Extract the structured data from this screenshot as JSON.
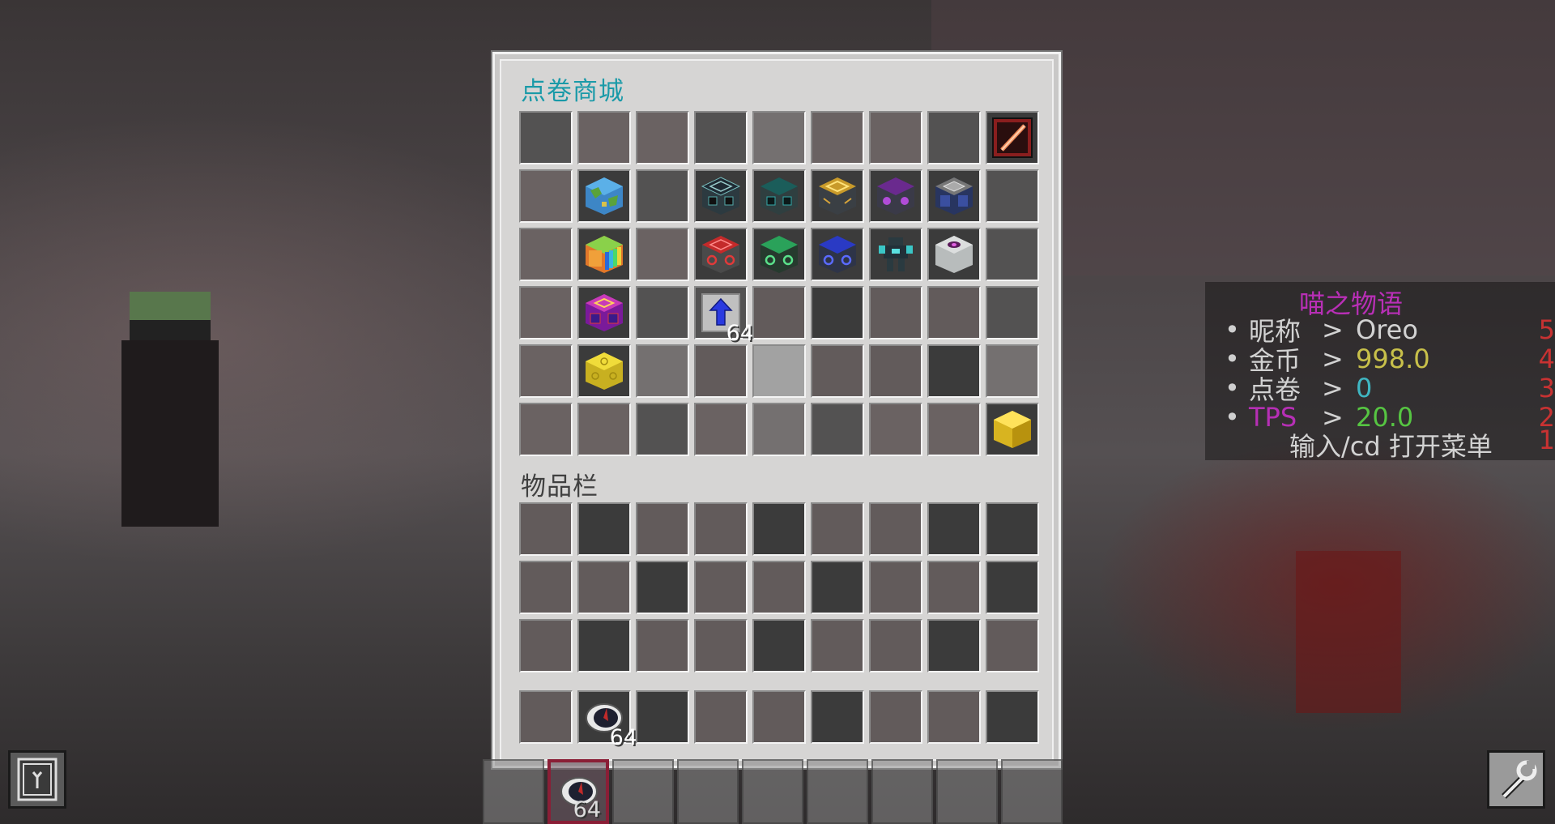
{
  "shop": {
    "title": "点卷商城",
    "slots": [
      {
        "c": "c-a"
      },
      {
        "c": "c-b"
      },
      {
        "c": "c-b"
      },
      {
        "c": "c-a"
      },
      {
        "c": "c-c"
      },
      {
        "c": "c-b"
      },
      {
        "c": "c-b"
      },
      {
        "c": "c-a"
      },
      {
        "c": "c-d",
        "icon": "red-sword-icon"
      },
      {
        "c": "c-b"
      },
      {
        "c": "c-d",
        "icon": "earth-block-icon"
      },
      {
        "c": "c-a"
      },
      {
        "c": "c-d",
        "icon": "machine-casing-cyan-icon"
      },
      {
        "c": "c-d",
        "icon": "machine-casing-teal-icon"
      },
      {
        "c": "c-d",
        "icon": "machine-casing-gold-icon"
      },
      {
        "c": "c-d",
        "icon": "machine-casing-purple-icon"
      },
      {
        "c": "c-d",
        "icon": "machine-casing-blue-icon"
      },
      {
        "c": "c-a"
      },
      {
        "c": "c-b"
      },
      {
        "c": "c-d",
        "icon": "rainbow-block-icon"
      },
      {
        "c": "c-b"
      },
      {
        "c": "c-d",
        "icon": "machine-red-icon"
      },
      {
        "c": "c-d",
        "icon": "machine-green-icon"
      },
      {
        "c": "c-d",
        "icon": "machine-blue-icon"
      },
      {
        "c": "c-d",
        "icon": "robot-armor-icon"
      },
      {
        "c": "c-d",
        "icon": "white-orb-block-icon"
      },
      {
        "c": "c-a"
      },
      {
        "c": "c-b"
      },
      {
        "c": "c-d",
        "icon": "purple-rune-block-icon"
      },
      {
        "c": "c-a"
      },
      {
        "c": "c-a",
        "icon": "blue-arrow-icon",
        "count": "64"
      },
      {
        "c": "c-f"
      },
      {
        "c": "c-d"
      },
      {
        "c": "c-f"
      },
      {
        "c": "c-f"
      },
      {
        "c": "c-a"
      },
      {
        "c": "c-b"
      },
      {
        "c": "c-d",
        "icon": "yellow-block-icon"
      },
      {
        "c": "c-c"
      },
      {
        "c": "c-f"
      },
      {
        "c": "c-e"
      },
      {
        "c": "c-f"
      },
      {
        "c": "c-f"
      },
      {
        "c": "c-d"
      },
      {
        "c": "c-c"
      },
      {
        "c": "c-b"
      },
      {
        "c": "c-b"
      },
      {
        "c": "c-a"
      },
      {
        "c": "c-b"
      },
      {
        "c": "c-c"
      },
      {
        "c": "c-a"
      },
      {
        "c": "c-b"
      },
      {
        "c": "c-b"
      },
      {
        "c": "c-d",
        "icon": "gold-cube-icon"
      }
    ]
  },
  "inventory": {
    "title": "物品栏",
    "slots": [
      {
        "c": "c-f"
      },
      {
        "c": "c-d"
      },
      {
        "c": "c-f"
      },
      {
        "c": "c-f"
      },
      {
        "c": "c-d"
      },
      {
        "c": "c-f"
      },
      {
        "c": "c-f"
      },
      {
        "c": "c-d"
      },
      {
        "c": "c-d"
      },
      {
        "c": "c-f"
      },
      {
        "c": "c-f"
      },
      {
        "c": "c-d"
      },
      {
        "c": "c-f"
      },
      {
        "c": "c-f"
      },
      {
        "c": "c-d"
      },
      {
        "c": "c-f"
      },
      {
        "c": "c-f"
      },
      {
        "c": "c-d"
      },
      {
        "c": "c-f"
      },
      {
        "c": "c-d"
      },
      {
        "c": "c-f"
      },
      {
        "c": "c-f"
      },
      {
        "c": "c-d"
      },
      {
        "c": "c-f"
      },
      {
        "c": "c-f"
      },
      {
        "c": "c-d"
      },
      {
        "c": "c-f"
      }
    ],
    "hotbar": [
      {
        "c": "c-f"
      },
      {
        "c": "c-d",
        "icon": "compass-disc-icon",
        "count": "64"
      },
      {
        "c": "c-d"
      },
      {
        "c": "c-f"
      },
      {
        "c": "c-f"
      },
      {
        "c": "c-d"
      },
      {
        "c": "c-f"
      },
      {
        "c": "c-f"
      },
      {
        "c": "c-d"
      }
    ]
  },
  "hotbar": {
    "selected_index": 1,
    "slots": [
      {},
      {
        "icon": "compass-disc-icon",
        "count": "64"
      },
      {},
      {},
      {},
      {},
      {},
      {},
      {}
    ]
  },
  "scoreboard": {
    "title": "喵之物语",
    "rows": [
      {
        "bullet": "•",
        "key": "昵称",
        "arrow": ">",
        "value": "Oreo",
        "value_color": "#d2d2d2",
        "key_color": "#d2d2d2",
        "num": "5"
      },
      {
        "bullet": "•",
        "key": "金币",
        "arrow": ">",
        "value": "998.0",
        "value_color": "#c8c04a",
        "key_color": "#d2d2d2",
        "num": "4"
      },
      {
        "bullet": "•",
        "key": "点卷",
        "arrow": ">",
        "value": "0",
        "value_color": "#3fb6c2",
        "key_color": "#d2d2d2",
        "num": "3"
      },
      {
        "bullet": "•",
        "key": "TPS",
        "arrow": ">",
        "value": "20.0",
        "value_color": "#56c542",
        "key_color": "#b62fb5",
        "num": "2"
      }
    ],
    "footer": "输入/cd 打开菜单",
    "footer_num": "1"
  },
  "corner_icons": {
    "left": "book-menu-icon",
    "right": "wrench-icon"
  }
}
